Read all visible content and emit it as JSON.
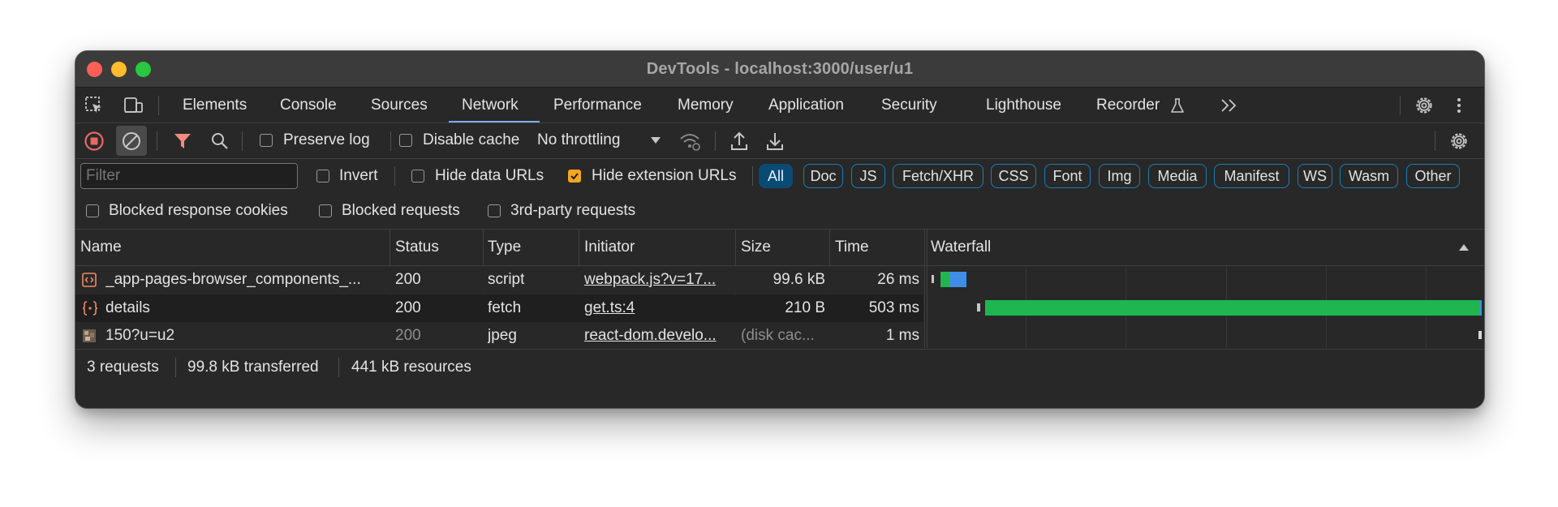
{
  "window": {
    "title": "DevTools - localhost:3000/user/u1"
  },
  "tabs": {
    "items": [
      {
        "label": "Elements"
      },
      {
        "label": "Console"
      },
      {
        "label": "Sources"
      },
      {
        "label": "Network"
      },
      {
        "label": "Performance"
      },
      {
        "label": "Memory"
      },
      {
        "label": "Application"
      },
      {
        "label": "Security"
      },
      {
        "label": "Lighthouse"
      },
      {
        "label": "Recorder"
      }
    ],
    "active": "Network"
  },
  "toolbar": {
    "preserve_log": "Preserve log",
    "disable_cache": "Disable cache",
    "throttling": "No throttling"
  },
  "filter": {
    "placeholder": "Filter",
    "invert": "Invert",
    "hide_data_urls": "Hide data URLs",
    "hide_extension_urls": "Hide extension URLs",
    "hide_extension_checked": true,
    "types": [
      "All",
      "Doc",
      "JS",
      "Fetch/XHR",
      "CSS",
      "Font",
      "Img",
      "Media",
      "Manifest",
      "WS",
      "Wasm",
      "Other"
    ],
    "active_type": "All",
    "blocked_cookies": "Blocked response cookies",
    "blocked_requests": "Blocked requests",
    "third_party": "3rd-party requests"
  },
  "table": {
    "headers": [
      "Name",
      "Status",
      "Type",
      "Initiator",
      "Size",
      "Time",
      "Waterfall"
    ],
    "rows": [
      {
        "name": "_app-pages-browser_components_...",
        "status": "200",
        "type": "script",
        "initiator": "webpack.js?v=17...",
        "size": "99.6 kB",
        "time": "26 ms",
        "icon": "script-icon"
      },
      {
        "name": "details",
        "status": "200",
        "type": "fetch",
        "initiator": "get.ts:4",
        "size": "210 B",
        "time": "503 ms",
        "icon": "fetch-icon"
      },
      {
        "name": "150?u=u2",
        "status": "200",
        "type": "jpeg",
        "initiator": "react-dom.develo...",
        "size": "(disk cac...",
        "time": "1 ms",
        "icon": "image-icon"
      }
    ]
  },
  "footer": {
    "requests": "3 requests",
    "transferred": "99.8 kB transferred",
    "resources": "441 kB resources"
  },
  "colors": {
    "accent": "#7cacf8",
    "record_red": "#e46962",
    "filter_red": "#f28b82",
    "waterfall_green": "#1fb550",
    "waterfall_blue": "#3e8ee8",
    "checkbox_orange": "#f5a623"
  }
}
